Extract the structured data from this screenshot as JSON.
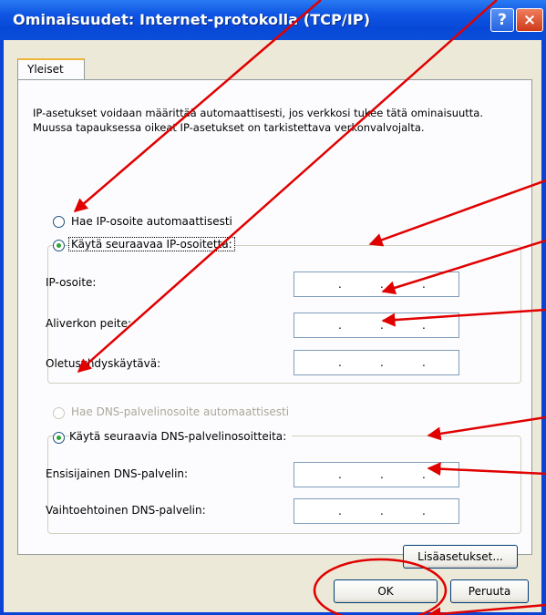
{
  "window": {
    "title": "Ominaisuudet: Internet-protokolla (TCP/IP)",
    "help_label": "?",
    "close_label": "×"
  },
  "tab": {
    "label": "Yleiset"
  },
  "description": "IP-asetukset voidaan määrittää automaattisesti, jos verkkosi tukee tätä ominaisuutta. Muussa tapauksessa oikeat IP-asetukset on tarkistettava verkonvalvojalta.",
  "ip_section": {
    "auto_label": "Hae IP-osoite automaattisesti",
    "manual_label": "Käytä seuraavaa IP-osoitetta:",
    "selected": "manual",
    "fields": [
      {
        "label": "IP-osoite:",
        "value": ""
      },
      {
        "label": "Aliverkon peite:",
        "value": ""
      },
      {
        "label": "Oletusyhdyskäytävä:",
        "value": ""
      }
    ]
  },
  "dns_section": {
    "auto_label": "Hae DNS-palvelinosoite automaattisesti",
    "manual_label": "Käytä seuraavia DNS-palvelinosoitteita:",
    "selected": "manual",
    "auto_disabled": true,
    "fields": [
      {
        "label": "Ensisijainen DNS-palvelin:",
        "value": ""
      },
      {
        "label": "Vaihtoehtoinen DNS-palvelin:",
        "value": ""
      }
    ]
  },
  "buttons": {
    "advanced_label": "Lisäasetukset...",
    "ok_label": "OK",
    "cancel_label": "Peruuta"
  },
  "colors": {
    "title_bar": "#0a43d6",
    "dialog_bg": "#ece9d8",
    "annotation": "#e00000"
  },
  "ip_separator": "."
}
